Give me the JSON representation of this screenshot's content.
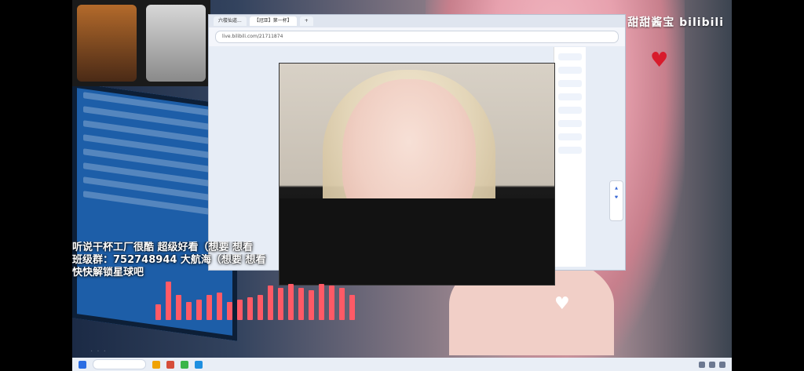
{
  "watermark": {
    "channel_name": "甜甜酱宝",
    "platform": "bilibili"
  },
  "browser": {
    "tabs": [
      "六楼仙道...",
      "【冠亚】第一杯】",
      "+"
    ],
    "address": "live.bilibili.com/21711874"
  },
  "overlay": {
    "line1": "听说干杯工厂很酷  超级好看（想要  想看",
    "line2": "班级群：752748944  大航海（想要  想看",
    "line3": "快快解锁星球吧"
  },
  "equalizer": {
    "levels": [
      0.35,
      0.85,
      0.55,
      0.4,
      0.45,
      0.55,
      0.6,
      0.4,
      0.45,
      0.5,
      0.55,
      0.75,
      0.7,
      0.8,
      0.7,
      0.65,
      0.8,
      0.75,
      0.7,
      0.55
    ]
  },
  "colors": {
    "accent": "#ff5a66",
    "heart_red": "#d81b2c"
  },
  "icons": {
    "heart": "heart-icon"
  }
}
